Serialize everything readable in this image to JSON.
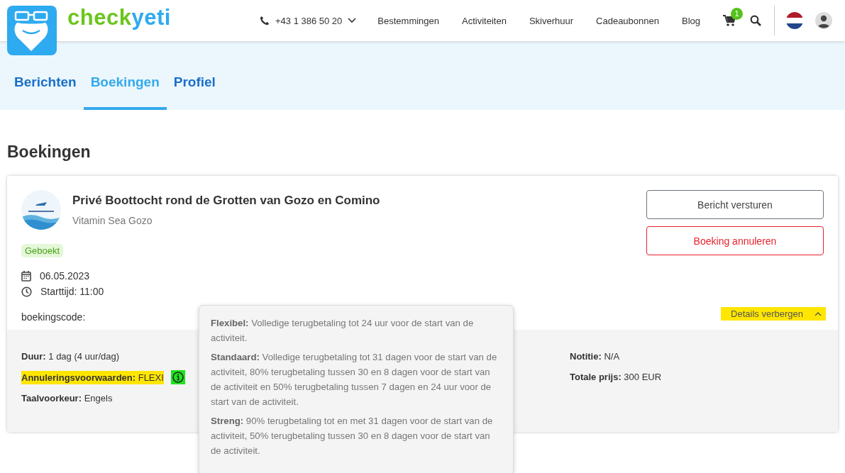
{
  "header": {
    "brand_first": "check",
    "brand_second": "yeti",
    "phone": "+43 1 386 50 20",
    "nav": [
      "Bestemmingen",
      "Activiteiten",
      "Skiverhuur",
      "Cadeaubonnen",
      "Blog"
    ],
    "cart_count": "1"
  },
  "tabs": [
    {
      "label": "Berichten",
      "selected": false
    },
    {
      "label": "Boekingen",
      "selected": true
    },
    {
      "label": "Profiel",
      "selected": false
    }
  ],
  "page_title": "Boekingen",
  "booking": {
    "title": "Privé Boottocht rond de Grotten van Gozo en Comino",
    "provider": "Vitamin Sea Gozo",
    "status": "Geboekt",
    "date": "06.05.2023",
    "start_time": "Starttijd: 11:00",
    "code_label": "boekingscode:",
    "buttons": [
      {
        "label": "Bericht versturen",
        "kind": "outline"
      },
      {
        "label": "Boeking annuleren",
        "kind": "danger"
      }
    ],
    "toggle": {
      "label": "Details verbergen",
      "highlighted": true
    }
  },
  "details": {
    "column_1": [
      {
        "label": "Duur:",
        "value": "1 dag (4 uur/dag)",
        "highlighted": false,
        "info": false
      },
      {
        "label": "Annuleringsvoorwaarden:",
        "value": "FLEXI",
        "highlighted": true,
        "info": true
      },
      {
        "label": "Taalvoorkeur:",
        "value": "Engels",
        "highlighted": false,
        "info": false
      }
    ],
    "column_3": [
      {
        "label": "Notitie:",
        "value": "N/A",
        "highlighted": false,
        "info": false
      },
      {
        "label": "Totale prijs:",
        "value": "300 EUR",
        "highlighted": false,
        "info": false
      }
    ]
  },
  "tooltip": [
    {
      "term": "Flexibel:",
      "text": "Volledige terugbetaling tot 24 uur voor de start van de activiteit."
    },
    {
      "term": "Standaard:",
      "text": "Volledige terugbetaling tot 31 dagen voor de start van de activiteit, 80% terugbetaling tussen 30 en 8 dagen voor de start van de activiteit en 50% terugbetaling tussen 7 dagen en 24 uur voor de start van de activiteit."
    },
    {
      "term": "Streng:",
      "text": "90% terugbetaling tot en met 31 dagen voor de start van de activiteit, 50% terugbetaling tussen 30 en 8 dagen voor de start van de activiteit."
    }
  ]
}
